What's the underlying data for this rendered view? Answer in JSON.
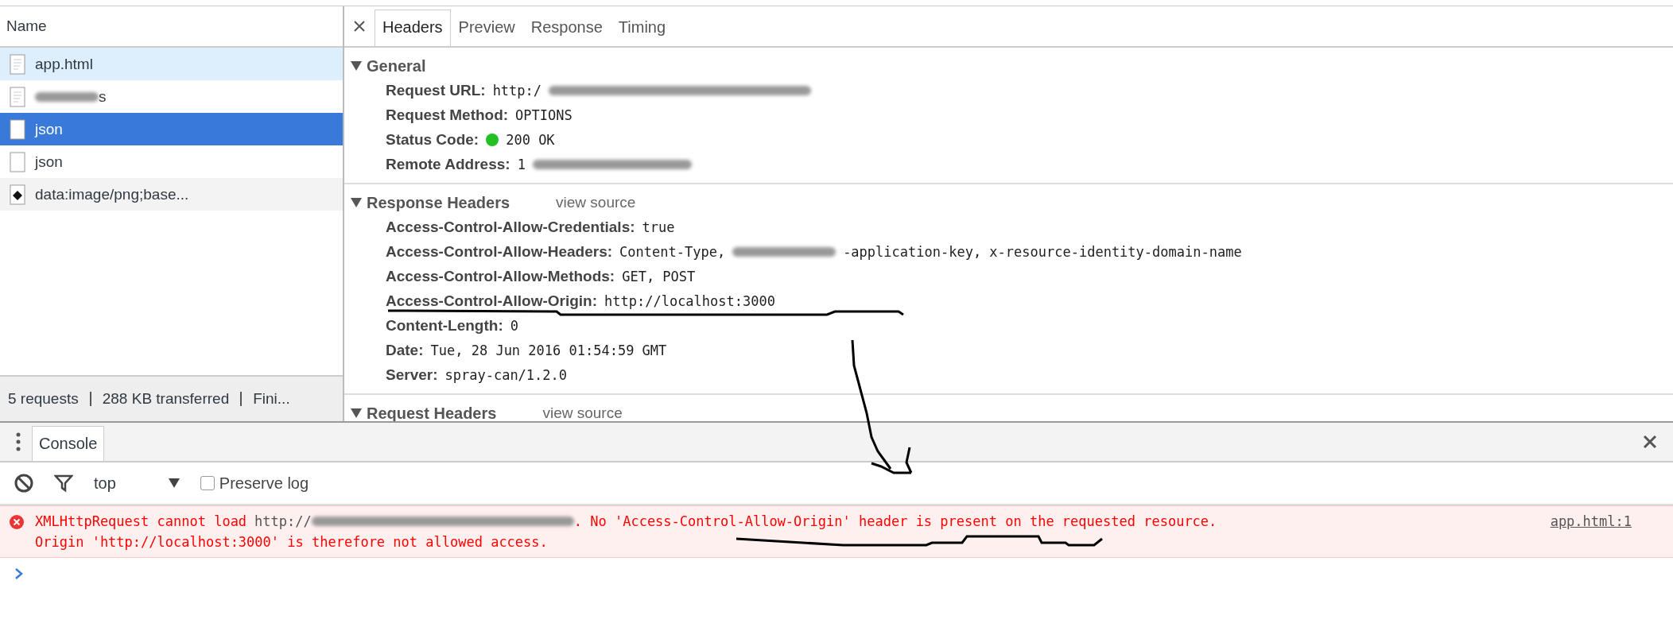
{
  "requests": {
    "column": "Name",
    "items": [
      {
        "name": "app.html",
        "kind": "document",
        "selected": false,
        "highlighted": true,
        "blurred": false
      },
      {
        "name": "s",
        "kind": "document",
        "selected": false,
        "highlighted": false,
        "blurred": true
      },
      {
        "name": "json",
        "kind": "blank",
        "selected": true,
        "highlighted": false,
        "blurred": false
      },
      {
        "name": "json",
        "kind": "blank",
        "selected": false,
        "highlighted": false,
        "blurred": false
      },
      {
        "name": "data:image/png;base...",
        "kind": "image",
        "selected": false,
        "highlighted": false,
        "blurred": false
      }
    ],
    "status": [
      "5 requests",
      "288 KB transferred",
      "Fini..."
    ]
  },
  "details": {
    "tabs": [
      {
        "label": "Headers",
        "selected": true
      },
      {
        "label": "Preview",
        "selected": false
      },
      {
        "label": "Response",
        "selected": false
      },
      {
        "label": "Timing",
        "selected": false
      }
    ],
    "sections": [
      {
        "title": "General",
        "expanded": true,
        "rows": [
          {
            "key": "Request URL:",
            "value": [
              {
                "kind": "text",
                "text": "http:/"
              },
              {
                "kind": "blur"
              }
            ]
          },
          {
            "key": "Request Method:",
            "value": [
              {
                "kind": "text",
                "text": "OPTIONS"
              }
            ]
          },
          {
            "key": "Status Code:",
            "value": [
              {
                "kind": "status",
                "color": "#22c022"
              },
              {
                "kind": "text",
                "text": "200 OK"
              }
            ]
          },
          {
            "key": "Remote Address:",
            "value": [
              {
                "kind": "text",
                "text": "1"
              },
              {
                "kind": "blur"
              }
            ]
          }
        ]
      },
      {
        "title": "Response Headers",
        "link": "view source",
        "expanded": true,
        "rows": [
          {
            "key": "Access-Control-Allow-Credentials:",
            "value": [
              {
                "kind": "text",
                "text": "true"
              }
            ]
          },
          {
            "key": "Access-Control-Allow-Headers:",
            "value": [
              {
                "kind": "text",
                "text": "Content-Type,"
              },
              {
                "kind": "blur"
              },
              {
                "kind": "text",
                "text": "-application-key, x-resource-identity-domain-name"
              }
            ]
          },
          {
            "key": "Access-Control-Allow-Methods:",
            "value": [
              {
                "kind": "text",
                "text": "GET, POST"
              }
            ]
          },
          {
            "key": "Access-Control-Allow-Origin:",
            "value": [
              {
                "kind": "text",
                "text": "http://localhost:3000"
              }
            ]
          },
          {
            "key": "Content-Length:",
            "value": [
              {
                "kind": "text",
                "text": "0"
              }
            ]
          },
          {
            "key": "Date:",
            "value": [
              {
                "kind": "text",
                "text": "Tue, 28 Jun 2016 01:54:59 GMT"
              }
            ]
          },
          {
            "key": "Server:",
            "value": [
              {
                "kind": "text",
                "text": "spray-can/1.2.0"
              }
            ]
          }
        ]
      },
      {
        "title": "Request Headers",
        "link": "view source",
        "expanded": true
      }
    ]
  },
  "drawer": {
    "tabs": [
      {
        "label": "Console",
        "selected": true
      }
    ],
    "toolbar": {
      "context": "top",
      "preserve_log": {
        "label": "Preserve log",
        "checked": false
      }
    },
    "messages": [
      {
        "kind": "error",
        "source": "app.html:1",
        "lines": [
          [
            {
              "kind": "text",
              "text": "XMLHttpRequest cannot load"
            },
            {
              "kind": "url",
              "text": "http://"
            },
            {
              "kind": "blur"
            },
            {
              "kind": "text",
              "text": ". No 'Access-Control-Allow-Origin' header is present on the requested resource."
            }
          ],
          [
            {
              "kind": "text",
              "text": "Origin 'http://localhost:3000' is therefore not allowed access."
            }
          ]
        ]
      }
    ]
  }
}
